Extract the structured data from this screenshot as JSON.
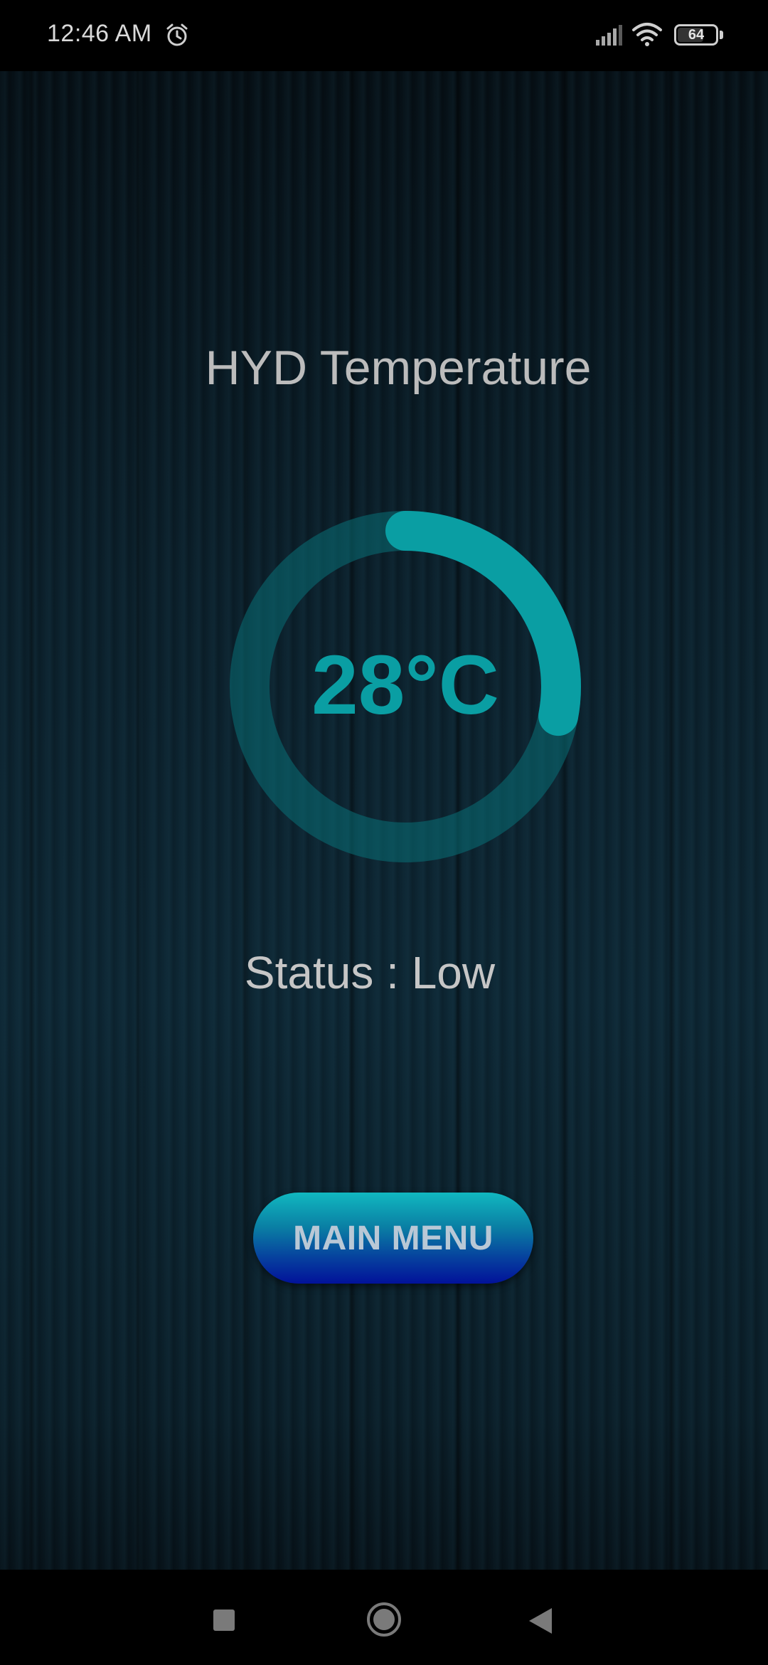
{
  "status_bar": {
    "time": "12:46 AM",
    "alarm_icon": "alarm-clock-icon",
    "signal_icon": "cellular-signal-icon",
    "wifi_icon": "wifi-icon",
    "battery_level": "64"
  },
  "main": {
    "title": "HYD Temperature",
    "gauge": {
      "value_text": "28°C",
      "fill_fraction": 0.28,
      "color": "#0a9ea3",
      "track_color": "#0a6f76"
    },
    "status_text": "Status : Low",
    "main_menu_button": "MAIN MENU"
  },
  "nav_bar": {
    "recents_icon": "square-recents-icon",
    "home_icon": "circle-home-icon",
    "back_icon": "triangle-back-icon"
  }
}
